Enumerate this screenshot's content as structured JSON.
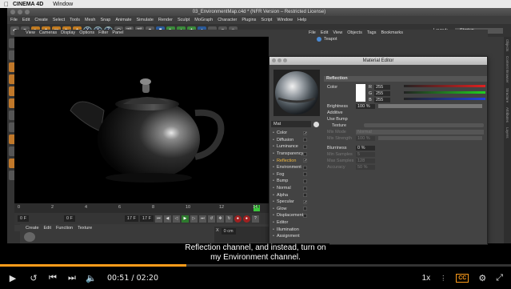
{
  "mac_menu": {
    "app": "CINEMA 4D",
    "window": "Window"
  },
  "app_title": "03_EnvironmentMap.c4d * (NFR Version – Restricted License)",
  "main_menu": [
    "File",
    "Edit",
    "Create",
    "Select",
    "Tools",
    "Mesh",
    "Snap",
    "Animate",
    "Simulate",
    "Render",
    "Sculpt",
    "MoGraph",
    "Character",
    "Plugins",
    "Script",
    "Window",
    "Help"
  ],
  "layout": {
    "label": "Layout:",
    "value": "Startup"
  },
  "toolbar_axes": [
    "X",
    "Y",
    "Z"
  ],
  "viewport_menu": [
    "View",
    "Cameras",
    "Display",
    "Options",
    "Filter",
    "Panel"
  ],
  "objects_menu": [
    "File",
    "Edit",
    "View",
    "Objects",
    "Tags",
    "Bookmarks"
  ],
  "object_item": "Teapot",
  "right_tabs": [
    "Objects",
    "Content Browser",
    "Structure",
    "Attributes",
    "Layers"
  ],
  "timeline": {
    "ticks": [
      "0",
      "2",
      "4",
      "6",
      "8",
      "10",
      "12",
      "14"
    ],
    "current": "14",
    "start_field": "0 F",
    "end_field": "17 F",
    "range_a": "0 F",
    "range_b": "17 F"
  },
  "material_manager_menu": [
    "Create",
    "Edit",
    "Function",
    "Texture"
  ],
  "material_editor": {
    "title": "Material Editor",
    "material_name": "Mat",
    "channels": [
      {
        "label": "Color",
        "checked": true
      },
      {
        "label": "Diffusion",
        "checked": false
      },
      {
        "label": "Luminance",
        "checked": false
      },
      {
        "label": "Transparency",
        "checked": false
      },
      {
        "label": "Reflection",
        "checked": true
      },
      {
        "label": "Environment",
        "checked": false
      },
      {
        "label": "Fog",
        "checked": false
      },
      {
        "label": "Bump",
        "checked": false
      },
      {
        "label": "Normal",
        "checked": false
      },
      {
        "label": "Alpha",
        "checked": false
      },
      {
        "label": "Specular",
        "checked": true
      },
      {
        "label": "Glow",
        "checked": false
      },
      {
        "label": "Displacement",
        "checked": false
      },
      {
        "label": "Editor",
        "checked": false
      },
      {
        "label": "Illumination",
        "checked": false
      },
      {
        "label": "Assignment",
        "checked": false
      }
    ],
    "active_channel": "Reflection",
    "section": "Reflection",
    "color_label": "Color",
    "rgb": {
      "r": "255",
      "g": "255",
      "b": "255"
    },
    "brightness_label": "Brightness",
    "brightness_value": "100 %",
    "additive_label": "Additive",
    "use_bump_label": "Use Bump",
    "texture_label": "Texture",
    "mix_mode_label": "Mix Mode",
    "mix_mode_value": "Normal",
    "mix_strength_label": "Mix Strength",
    "mix_strength_value": "100 %",
    "blurriness_label": "Blurriness",
    "blurriness_value": "0 %",
    "min_samples_label": "Min Samples",
    "min_samples_value": "5",
    "max_samples_label": "Max Samples",
    "max_samples_value": "128",
    "accuracy_label": "Accuracy",
    "accuracy_value": "50 %"
  },
  "coords": {
    "x_label": "X",
    "x_value": "0 cm"
  },
  "caption": {
    "line1": "Reflection channel, and instead, turn on",
    "line2": "my Environment channel."
  },
  "player": {
    "current_time": "00:51",
    "total_time": "02:20",
    "time_sep": " / ",
    "progress": 0.364,
    "speed": "1x",
    "cc": "CC"
  },
  "colors": {
    "accent": "#ff9c1a",
    "active_channel": "#f0b840"
  }
}
